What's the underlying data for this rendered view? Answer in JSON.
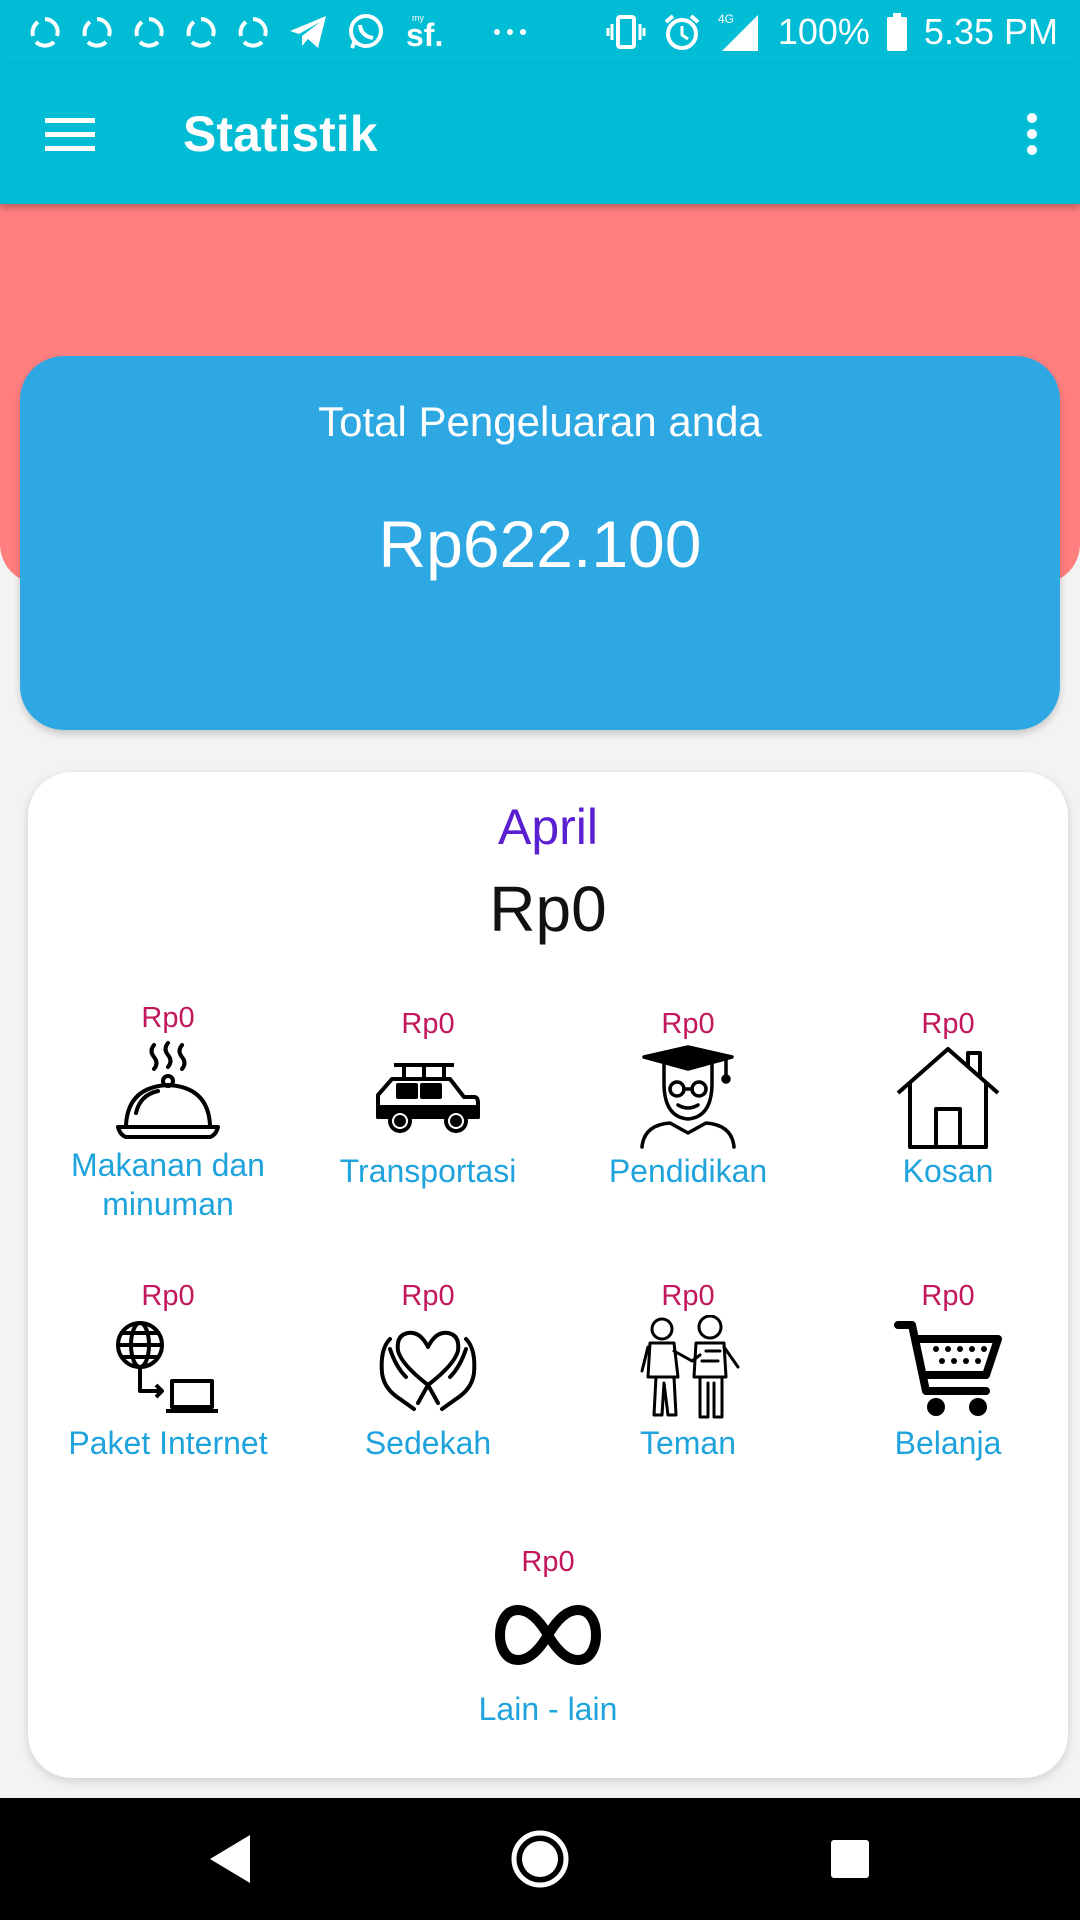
{
  "status_bar": {
    "time": "5.35 PM",
    "battery": "100%",
    "network": "4G",
    "icons": [
      "sync-icon",
      "sync-icon",
      "sync-icon",
      "sync-icon",
      "sync-icon",
      "telegram-icon",
      "whatsapp-icon",
      "mysf-icon",
      "more-notifications-icon",
      "vibrate-icon",
      "alarm-icon",
      "signal-icon",
      "battery-icon"
    ]
  },
  "app_bar": {
    "title": "Statistik"
  },
  "summary": {
    "label": "Total Pengeluaran anda",
    "amount": "Rp622.100"
  },
  "month": {
    "name": "April",
    "total": "Rp0",
    "categories": [
      {
        "label": "Makanan dan minuman",
        "amount": "Rp0",
        "icon": "food-cloche-icon"
      },
      {
        "label": "Transportasi",
        "amount": "Rp0",
        "icon": "car-icon"
      },
      {
        "label": "Pendidikan",
        "amount": "Rp0",
        "icon": "graduate-icon"
      },
      {
        "label": "Kosan",
        "amount": "Rp0",
        "icon": "house-icon"
      },
      {
        "label": "Paket Internet",
        "amount": "Rp0",
        "icon": "internet-icon"
      },
      {
        "label": "Sedekah",
        "amount": "Rp0",
        "icon": "charity-hands-icon"
      },
      {
        "label": "Teman",
        "amount": "Rp0",
        "icon": "friends-icon"
      },
      {
        "label": "Belanja",
        "amount": "Rp0",
        "icon": "shopping-cart-icon"
      },
      {
        "label": "Lain - lain",
        "amount": "Rp0",
        "icon": "infinity-icon"
      }
    ]
  },
  "colors": {
    "primary": "#00bcd4",
    "header_band": "#ff7f7f",
    "summary_card": "#2ea8e3",
    "month_name": "#5a1fd1",
    "category_amount": "#c2185b",
    "category_label": "#1fa3dd"
  }
}
